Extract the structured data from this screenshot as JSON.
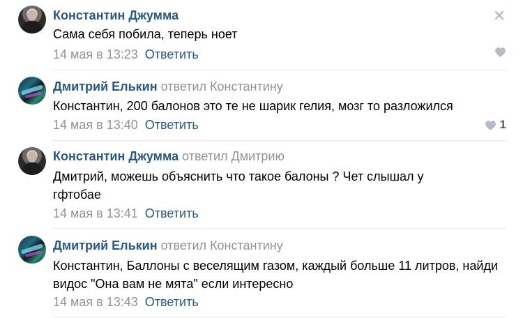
{
  "comments": [
    {
      "author": "Константин Джумма",
      "replied": "",
      "text": "Сама себя побила, теперь ноет",
      "date": "14 мая в 13:23",
      "reply_label": "Ответить",
      "likes": ""
    },
    {
      "author": "Дмитрий Елькин",
      "replied": "ответил Константину",
      "text": "Константин, 200 балонов это те не шарик гелия, мозг то разложился",
      "date": "14 мая в 13:40",
      "reply_label": "Ответить",
      "likes": "1"
    },
    {
      "author": "Константин Джумма",
      "replied": "ответил Дмитрию",
      "text": "Дмитрий, можешь объяснить что такое балоны ? Чет слышал у гфтобае",
      "date": "14 мая в 13:41",
      "reply_label": "Ответить",
      "likes": ""
    },
    {
      "author": "Дмитрий Елькин",
      "replied": "ответил Константину",
      "text": "Константин, Баллоны с веселящим газом, каждый больше 11 литров, найди видос \"Она вам не мята\" если интересно",
      "date": "14 мая в 13:43",
      "reply_label": "Ответить",
      "likes": ""
    }
  ],
  "icons": {
    "close": "close-icon",
    "like": "heart-icon"
  }
}
